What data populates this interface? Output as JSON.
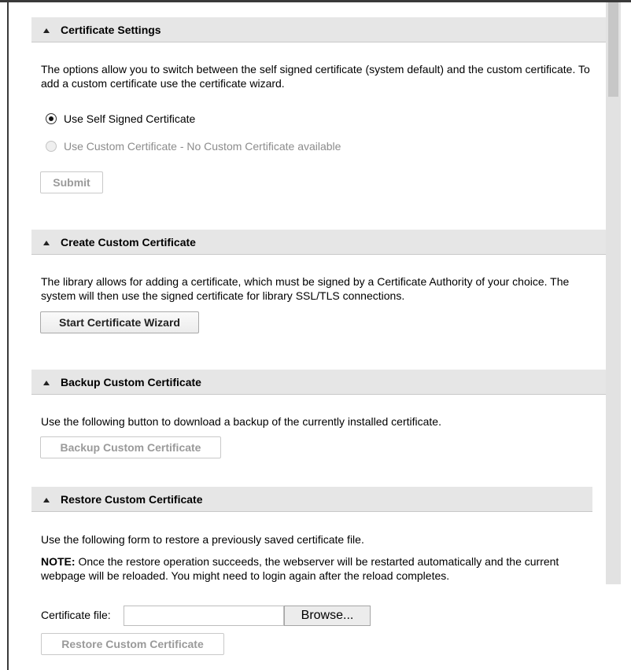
{
  "sections": {
    "certificate_settings": {
      "title": "Certificate Settings",
      "description": "The options allow you to switch between the self signed certificate (system default) and the custom certificate. To add a custom certificate use the certificate wizard.",
      "radio_self_signed": "Use Self Signed Certificate",
      "radio_custom": "Use Custom Certificate - No Custom Certificate available",
      "submit_label": "Submit"
    },
    "create_custom": {
      "title": "Create Custom Certificate",
      "description": "The library allows for adding a certificate, which must be signed by a Certificate Authority of your choice. The system will then use the signed certificate for library SSL/TLS connections.",
      "wizard_label": "Start Certificate Wizard"
    },
    "backup_custom": {
      "title": "Backup Custom Certificate",
      "description": "Use the following button to download a backup of the currently installed certificate.",
      "backup_label": "Backup Custom Certificate"
    },
    "restore_custom": {
      "title": "Restore Custom Certificate",
      "description": "Use the following form to restore a previously saved certificate file.",
      "note_label": "NOTE:",
      "note_text": "Once the restore operation succeeds, the webserver will be restarted automatically and the current webpage will be reloaded. You might need to login again after the reload completes.",
      "file_label": "Certificate file:",
      "file_value": "",
      "browse_label": "Browse...",
      "restore_label": "Restore Custom Certificate"
    }
  },
  "colors": {
    "header_bg": "#e6e6e6",
    "disabled_text": "#9a9a9a",
    "scrollbar_track": "#e2e2e2",
    "scrollbar_thumb": "#c7c7c7"
  }
}
